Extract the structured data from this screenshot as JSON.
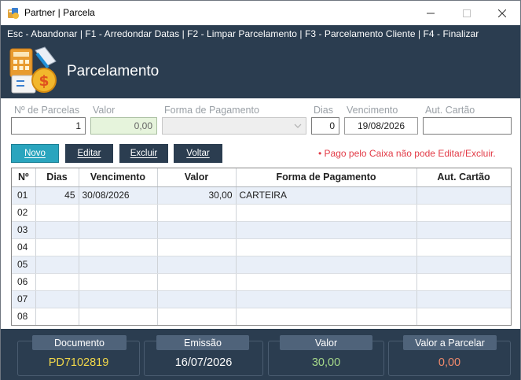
{
  "window": {
    "title": "Partner | Parcela"
  },
  "header": {
    "shortcuts": "Esc - Abandonar | F1 - Arredondar Datas | F2 - Limpar Parcelamento | F3 - Parcelamento Cliente | F4 - Finalizar",
    "title": "Parcelamento",
    "icon": "calculator-money-icon"
  },
  "form": {
    "parcelas": {
      "label": "Nº de Parcelas",
      "value": "1"
    },
    "valor": {
      "label": "Valor",
      "value": "0,00"
    },
    "forma": {
      "label": "Forma de Pagamento",
      "value": ""
    },
    "dias": {
      "label": "Dias",
      "value": "0"
    },
    "vencimento": {
      "label": "Vencimento",
      "value": "19/08/2026"
    },
    "autcartao": {
      "label": "Aut. Cartão",
      "value": ""
    }
  },
  "buttons": {
    "novo": "Novo",
    "editar": "Editar",
    "excluir": "Excluir",
    "voltar": "Voltar"
  },
  "warning": "• Pago pelo Caixa não pode Editar/Excluir.",
  "table": {
    "columns": [
      "Nº",
      "Dias",
      "Vencimento",
      "Valor",
      "Forma de Pagamento",
      "Aut. Cartão"
    ],
    "rows": [
      [
        "01",
        "45",
        "30/08/2026",
        "30,00",
        "CARTEIRA",
        ""
      ],
      [
        "02",
        "",
        "",
        "",
        "",
        ""
      ],
      [
        "03",
        "",
        "",
        "",
        "",
        ""
      ],
      [
        "04",
        "",
        "",
        "",
        "",
        ""
      ],
      [
        "05",
        "",
        "",
        "",
        "",
        ""
      ],
      [
        "06",
        "",
        "",
        "",
        "",
        ""
      ],
      [
        "07",
        "",
        "",
        "",
        "",
        ""
      ],
      [
        "08",
        "",
        "",
        "",
        "",
        ""
      ]
    ]
  },
  "footer": {
    "documento": {
      "label": "Documento",
      "value": "PD7102819",
      "color": "#f2d84a"
    },
    "emissao": {
      "label": "Emissão",
      "value": "16/07/2026",
      "color": "#ffffff"
    },
    "valor": {
      "label": "Valor",
      "value": "30,00",
      "color": "#a6d98a"
    },
    "valor_parcelar": {
      "label": "Valor a Parcelar",
      "value": "0,00",
      "color": "#f08a6c"
    }
  },
  "colors": {
    "header_bg": "#2b3d50",
    "accent": "#2aa5be",
    "warning": "#e23a46"
  }
}
